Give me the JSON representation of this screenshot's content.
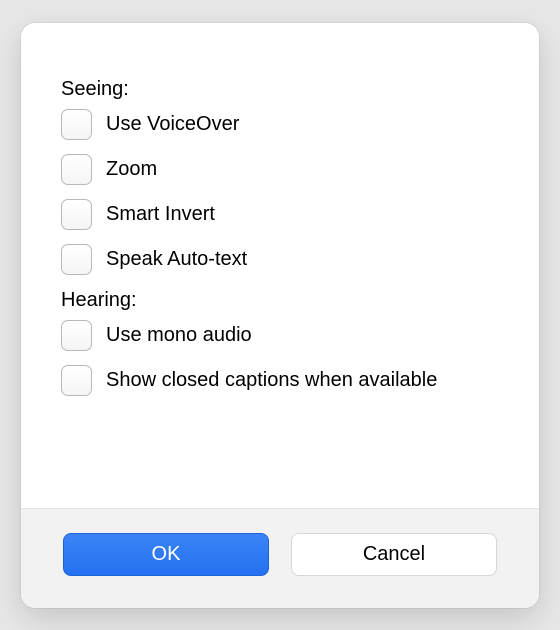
{
  "sections": {
    "seeing": {
      "title": "Seeing:",
      "options": [
        {
          "label": "Use VoiceOver",
          "checked": false
        },
        {
          "label": "Zoom",
          "checked": false
        },
        {
          "label": "Smart Invert",
          "checked": false
        },
        {
          "label": "Speak Auto-text",
          "checked": false
        }
      ]
    },
    "hearing": {
      "title": "Hearing:",
      "options": [
        {
          "label": "Use mono audio",
          "checked": false
        },
        {
          "label": "Show closed captions when available",
          "checked": false
        }
      ]
    }
  },
  "buttons": {
    "ok": "OK",
    "cancel": "Cancel"
  }
}
